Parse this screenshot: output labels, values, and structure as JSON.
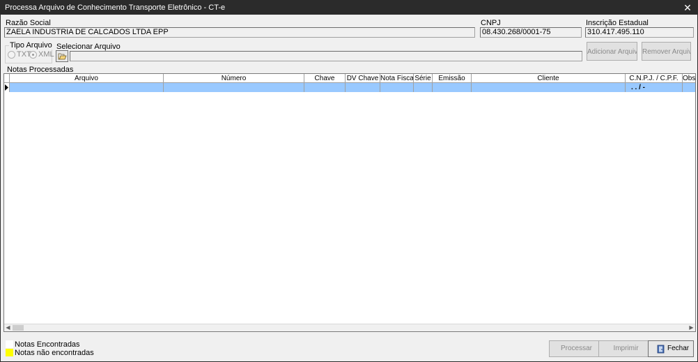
{
  "window": {
    "title": "Processa Arquivo de Conhecimento Transporte Eletrônico - CT-e",
    "close_glyph": "✕"
  },
  "company": {
    "razao_social_label": "Razão Social",
    "razao_social_value": "ZAELA INDUSTRIA DE CALCADOS LTDA EPP",
    "cnpj_label": "CNPJ",
    "cnpj_value": "08.430.268/0001-75",
    "ie_label": "Inscrição Estadual",
    "ie_value": "310.417.495.110"
  },
  "file_type": {
    "group_label": "Tipo Arquivo",
    "options": [
      {
        "label": "TXT",
        "selected": false
      },
      {
        "label": "XML",
        "selected": true
      }
    ]
  },
  "file_select": {
    "label": "Selecionar Arquivo",
    "value": "",
    "folder_icon": "folder-open-icon"
  },
  "buttons": {
    "add_file": "Adicionar Arquivo",
    "remove_file": "Remover Arquivo",
    "process": "Processar",
    "print": "Imprimir",
    "close": "Fechar"
  },
  "grid": {
    "section_label": "Notas Processadas",
    "columns": [
      "Arquivo",
      "Número",
      "Chave",
      "DV Chave",
      "Nota Fiscal",
      "Série",
      "Emissão",
      "Cliente",
      "C.N.P.J. / C.P.F.",
      "Observação"
    ],
    "rows": [
      {
        "arquivo": "",
        "numero": "",
        "chave": "",
        "dv_chave": "",
        "nota_fiscal": "",
        "serie": "",
        "emissao": "",
        "cliente": "",
        "cnpj_cpf": ". . /  -",
        "observacao": ""
      }
    ]
  },
  "legend": {
    "found_label": "Notas Encontradas",
    "found_color": "#ffffff",
    "not_found_label": "Notas não encontradas",
    "not_found_color": "#ffff00"
  },
  "colors": {
    "titlebar": "#2b2b2b",
    "selected_row": "#99c9ff",
    "background": "#f0f0f0"
  }
}
